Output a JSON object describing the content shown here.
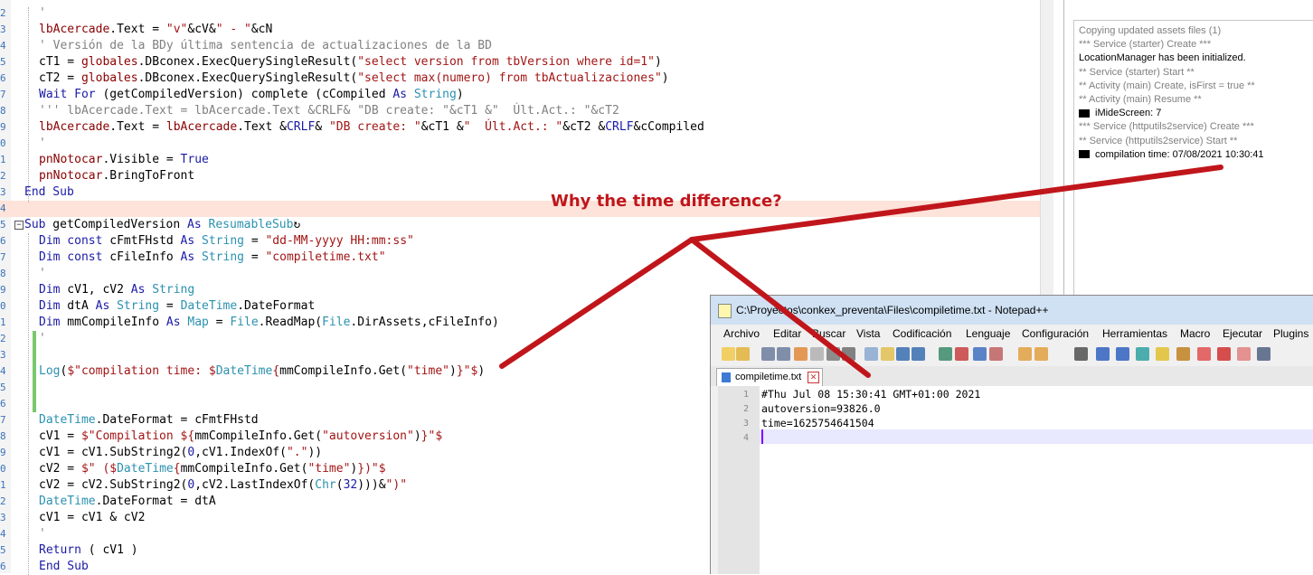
{
  "code_lines": [
    {
      "num": "2",
      "segs": [
        {
          "c": "cm",
          "t": "'"
        }
      ]
    },
    {
      "num": "3",
      "segs": [
        {
          "c": "id",
          "t": "lbAcercade"
        },
        {
          "c": "",
          "t": ".Text = "
        },
        {
          "c": "st",
          "t": "\"v\""
        },
        {
          "c": "",
          "t": "&cV&"
        },
        {
          "c": "st",
          "t": "\" - \""
        },
        {
          "c": "",
          "t": "&cN"
        }
      ]
    },
    {
      "num": "4",
      "segs": [
        {
          "c": "cm",
          "t": "' Versión de la BDy última sentencia de actualizaciones de la BD"
        }
      ]
    },
    {
      "num": "5",
      "segs": [
        {
          "c": "",
          "t": "cT1 = "
        },
        {
          "c": "id",
          "t": "globales"
        },
        {
          "c": "",
          "t": ".DBconex.ExecQuerySingleResult("
        },
        {
          "c": "st",
          "t": "\"select version from tbVersion where id=1\""
        },
        {
          "c": "",
          "t": ")"
        }
      ]
    },
    {
      "num": "6",
      "segs": [
        {
          "c": "",
          "t": "cT2 = "
        },
        {
          "c": "id",
          "t": "globales"
        },
        {
          "c": "",
          "t": ".DBconex.ExecQuerySingleResult("
        },
        {
          "c": "st",
          "t": "\"select max(numero) from tbActualizaciones\""
        },
        {
          "c": "",
          "t": ")"
        }
      ]
    },
    {
      "num": "7",
      "segs": [
        {
          "c": "kw",
          "t": "Wait For"
        },
        {
          "c": "",
          "t": " (getCompiledVersion) complete (cCompiled "
        },
        {
          "c": "kw",
          "t": "As"
        },
        {
          "c": "",
          "t": " "
        },
        {
          "c": "ty",
          "t": "String"
        },
        {
          "c": "",
          "t": ")"
        }
      ]
    },
    {
      "num": "8",
      "segs": [
        {
          "c": "cm",
          "t": "''' lbAcercade.Text = lbAcercade.Text &CRLF& \"DB create: \"&cT1 &\"  Últ.Act.: \"&cT2"
        }
      ]
    },
    {
      "num": "9",
      "segs": [
        {
          "c": "id",
          "t": "lbAcercade"
        },
        {
          "c": "",
          "t": ".Text = "
        },
        {
          "c": "id",
          "t": "lbAcercade"
        },
        {
          "c": "",
          "t": ".Text &"
        },
        {
          "c": "kw",
          "t": "CRLF"
        },
        {
          "c": "",
          "t": "& "
        },
        {
          "c": "st",
          "t": "\"DB create: \""
        },
        {
          "c": "",
          "t": "&cT1 &"
        },
        {
          "c": "st",
          "t": "\"  Últ.Act.: \""
        },
        {
          "c": "",
          "t": "&cT2 &"
        },
        {
          "c": "kw",
          "t": "CRLF"
        },
        {
          "c": "",
          "t": "&cCompiled"
        }
      ]
    },
    {
      "num": "0",
      "segs": [
        {
          "c": "cm",
          "t": "'"
        }
      ]
    },
    {
      "num": "1",
      "segs": [
        {
          "c": "id",
          "t": "pnNotocar"
        },
        {
          "c": "",
          "t": ".Visible = "
        },
        {
          "c": "kw",
          "t": "True"
        }
      ]
    },
    {
      "num": "2",
      "segs": [
        {
          "c": "id",
          "t": "pnNotocar"
        },
        {
          "c": "",
          "t": ".BringToFront"
        }
      ]
    },
    {
      "num": "3",
      "segs": [
        {
          "c": "kw",
          "t": "End Sub"
        }
      ]
    },
    {
      "num": "4",
      "segs": []
    },
    {
      "num": "5",
      "segs": [
        {
          "c": "kw",
          "t": "Sub"
        },
        {
          "c": "",
          "t": " getCompiledVersion "
        },
        {
          "c": "kw",
          "t": "As"
        },
        {
          "c": "",
          "t": " "
        },
        {
          "c": "ty",
          "t": "ResumableSub"
        },
        {
          "c": "",
          "t": "↻"
        }
      ]
    },
    {
      "num": "6",
      "segs": [
        {
          "c": "kw",
          "t": "Dim const"
        },
        {
          "c": "",
          "t": " cFmtFHstd "
        },
        {
          "c": "kw",
          "t": "As"
        },
        {
          "c": "",
          "t": " "
        },
        {
          "c": "ty",
          "t": "String"
        },
        {
          "c": "",
          "t": " = "
        },
        {
          "c": "st",
          "t": "\"dd-MM-yyyy HH:mm:ss\""
        }
      ]
    },
    {
      "num": "7",
      "segs": [
        {
          "c": "kw",
          "t": "Dim const"
        },
        {
          "c": "",
          "t": " cFileInfo "
        },
        {
          "c": "kw",
          "t": "As"
        },
        {
          "c": "",
          "t": " "
        },
        {
          "c": "ty",
          "t": "String"
        },
        {
          "c": "",
          "t": " = "
        },
        {
          "c": "st",
          "t": "\"compiletime.txt\""
        }
      ]
    },
    {
      "num": "8",
      "segs": [
        {
          "c": "cm",
          "t": "'"
        }
      ]
    },
    {
      "num": "9",
      "segs": [
        {
          "c": "kw",
          "t": "Dim"
        },
        {
          "c": "",
          "t": " cV1, cV2 "
        },
        {
          "c": "kw",
          "t": "As"
        },
        {
          "c": "",
          "t": " "
        },
        {
          "c": "ty",
          "t": "String"
        }
      ]
    },
    {
      "num": "0",
      "segs": [
        {
          "c": "kw",
          "t": "Dim"
        },
        {
          "c": "",
          "t": " dtA "
        },
        {
          "c": "kw",
          "t": "As"
        },
        {
          "c": "",
          "t": " "
        },
        {
          "c": "ty",
          "t": "String"
        },
        {
          "c": "",
          "t": " = "
        },
        {
          "c": "ty",
          "t": "DateTime"
        },
        {
          "c": "",
          "t": ".DateFormat"
        }
      ]
    },
    {
      "num": "1",
      "segs": [
        {
          "c": "kw",
          "t": "Dim"
        },
        {
          "c": "",
          "t": " mmCompileInfo "
        },
        {
          "c": "kw",
          "t": "As"
        },
        {
          "c": "",
          "t": " "
        },
        {
          "c": "ty",
          "t": "Map"
        },
        {
          "c": "",
          "t": " = "
        },
        {
          "c": "ty",
          "t": "File"
        },
        {
          "c": "",
          "t": ".ReadMap("
        },
        {
          "c": "ty",
          "t": "File"
        },
        {
          "c": "",
          "t": ".DirAssets,cFileInfo)"
        }
      ]
    },
    {
      "num": "2",
      "segs": [
        {
          "c": "cm",
          "t": "'"
        }
      ]
    },
    {
      "num": "3",
      "segs": []
    },
    {
      "num": "4",
      "segs": [
        {
          "c": "ty",
          "t": "Log"
        },
        {
          "c": "",
          "t": "("
        },
        {
          "c": "st",
          "t": "$\"compilation time: $"
        },
        {
          "c": "ty",
          "t": "DateTime"
        },
        {
          "c": "st",
          "t": "{"
        },
        {
          "c": "",
          "t": "mmCompileInfo.Get("
        },
        {
          "c": "st",
          "t": "\"time\""
        },
        {
          "c": "",
          "t": ")"
        },
        {
          "c": "st",
          "t": "}\"$"
        },
        {
          "c": "",
          "t": ")"
        }
      ]
    },
    {
      "num": "5",
      "segs": []
    },
    {
      "num": "6",
      "segs": []
    },
    {
      "num": "7",
      "segs": [
        {
          "c": "ty",
          "t": "DateTime"
        },
        {
          "c": "",
          "t": ".DateFormat = cFmtFHstd"
        }
      ]
    },
    {
      "num": "8",
      "segs": [
        {
          "c": "",
          "t": "cV1 = "
        },
        {
          "c": "st",
          "t": "$\"Compilation ${"
        },
        {
          "c": "",
          "t": "mmCompileInfo.Get("
        },
        {
          "c": "st",
          "t": "\"autoversion\""
        },
        {
          "c": "",
          "t": ")"
        },
        {
          "c": "st",
          "t": "}\"$"
        }
      ]
    },
    {
      "num": "9",
      "segs": [
        {
          "c": "",
          "t": "cV1 = cV1.SubString2("
        },
        {
          "c": "kw",
          "t": "0"
        },
        {
          "c": "",
          "t": ",cV1.IndexOf("
        },
        {
          "c": "st",
          "t": "\".\""
        },
        {
          "c": "",
          "t": "))"
        }
      ]
    },
    {
      "num": "0",
      "segs": [
        {
          "c": "",
          "t": "cV2 = "
        },
        {
          "c": "st",
          "t": "$\" ($"
        },
        {
          "c": "ty",
          "t": "DateTime"
        },
        {
          "c": "st",
          "t": "{"
        },
        {
          "c": "",
          "t": "mmCompileInfo.Get("
        },
        {
          "c": "st",
          "t": "\"time\""
        },
        {
          "c": "",
          "t": ")"
        },
        {
          "c": "st",
          "t": "})\"$"
        }
      ]
    },
    {
      "num": "1",
      "segs": [
        {
          "c": "",
          "t": "cV2 = cV2.SubString2("
        },
        {
          "c": "kw",
          "t": "0"
        },
        {
          "c": "",
          "t": ",cV2.LastIndexOf("
        },
        {
          "c": "ty",
          "t": "Chr"
        },
        {
          "c": "",
          "t": "("
        },
        {
          "c": "kw",
          "t": "32"
        },
        {
          "c": "",
          "t": ")))&"
        },
        {
          "c": "st",
          "t": "\")\""
        }
      ]
    },
    {
      "num": "2",
      "segs": [
        {
          "c": "ty",
          "t": "DateTime"
        },
        {
          "c": "",
          "t": ".DateFormat = dtA"
        }
      ]
    },
    {
      "num": "3",
      "segs": [
        {
          "c": "",
          "t": "cV1 = cV1 & cV2"
        }
      ]
    },
    {
      "num": "4",
      "segs": [
        {
          "c": "cm",
          "t": "'"
        }
      ]
    },
    {
      "num": "5",
      "segs": [
        {
          "c": "kw",
          "t": "Return"
        },
        {
          "c": "",
          "t": " ( cV1 )"
        }
      ]
    },
    {
      "num": "6",
      "segs": [
        {
          "c": "kw",
          "t": "End Sub"
        }
      ]
    }
  ],
  "log": [
    {
      "text": "Copying updated assets files (1)",
      "style": "gray",
      "arrow": false
    },
    {
      "text": "*** Service (starter) Create ***",
      "style": "gray",
      "arrow": false
    },
    {
      "text": "LocationManager has been initialized.",
      "style": "black",
      "arrow": false
    },
    {
      "text": "** Service (starter) Start **",
      "style": "gray",
      "arrow": false
    },
    {
      "text": "** Activity (main) Create, isFirst = true **",
      "style": "gray",
      "arrow": false
    },
    {
      "text": "** Activity (main) Resume **",
      "style": "gray",
      "arrow": false
    },
    {
      "text": "iMideScreen: 7",
      "style": "black",
      "arrow": true
    },
    {
      "text": "*** Service (httputils2service) Create ***",
      "style": "gray",
      "arrow": false
    },
    {
      "text": "** Service (httputils2service) Start **",
      "style": "gray",
      "arrow": false
    },
    {
      "text": "compilation time: 07/08/2021 10:30:41",
      "style": "black",
      "arrow": true
    }
  ],
  "annotation": "Why the time difference?",
  "notepad": {
    "title": "C:\\Proyectos\\conkex_preventa\\Files\\compiletime.txt - Notepad++",
    "menu": [
      "Archivo",
      "Editar",
      "Buscar",
      "Vista",
      "Codificación",
      "Lenguaje",
      "Configuración",
      "Herramientas",
      "Macro",
      "Ejecutar",
      "Plugins"
    ],
    "tab": "compiletime.txt",
    "lines": [
      {
        "num": "1",
        "text": "#Thu Jul 08 15:30:41 GMT+01:00 2021"
      },
      {
        "num": "2",
        "text": "autoversion=93826.0"
      },
      {
        "num": "3",
        "text": "time=1625754641504"
      },
      {
        "num": "4",
        "text": ""
      }
    ]
  },
  "colors": {
    "annotation": "#c0161b",
    "arrow": "#c0161b",
    "highlight_row": "#fde3d9"
  }
}
